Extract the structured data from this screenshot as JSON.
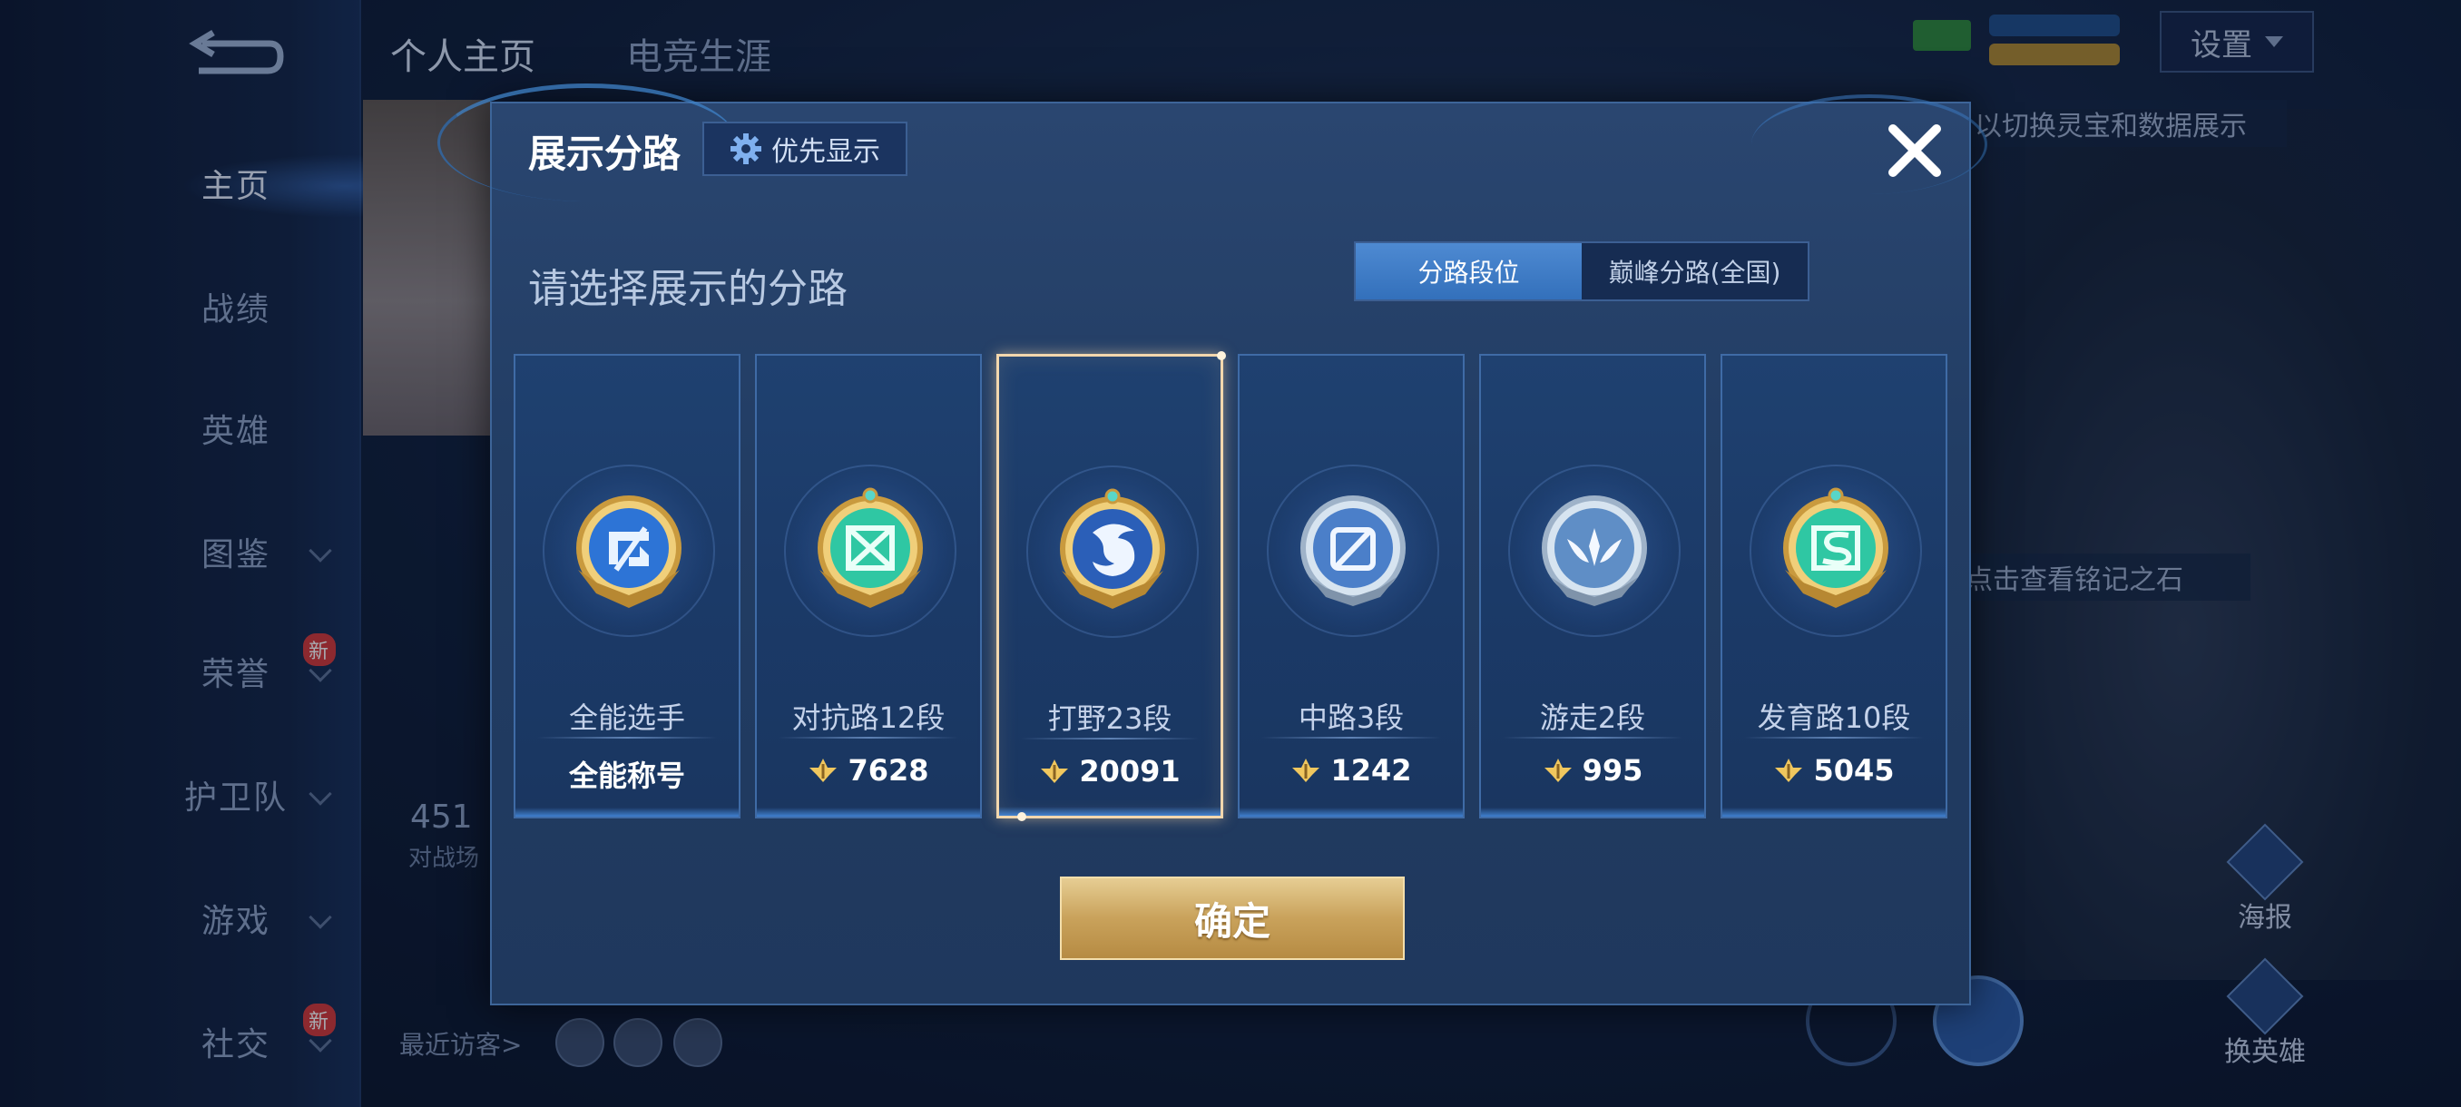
{
  "background": {
    "nav": [
      {
        "label": "主页",
        "active": true,
        "chevron": false,
        "badge": ""
      },
      {
        "label": "战绩",
        "active": false,
        "chevron": false,
        "badge": ""
      },
      {
        "label": "英雄",
        "active": false,
        "chevron": false,
        "badge": ""
      },
      {
        "label": "图鉴",
        "active": false,
        "chevron": true,
        "badge": ""
      },
      {
        "label": "荣誉",
        "active": false,
        "chevron": true,
        "badge": "新"
      },
      {
        "label": "护卫队",
        "active": false,
        "chevron": true,
        "badge": ""
      },
      {
        "label": "游戏",
        "active": false,
        "chevron": true,
        "badge": ""
      },
      {
        "label": "社交",
        "active": false,
        "chevron": true,
        "badge": "新"
      }
    ],
    "top_tabs": [
      "个人主页",
      "电竞生涯"
    ],
    "settings_label": "设置",
    "hint_text": "以切换灵宝和数据展示",
    "hint_text2": "点击查看铭记之石",
    "stat_value": "451",
    "stat_label": "对战场",
    "recent_visitors_label": "最近访客>",
    "side_buttons": [
      "海报",
      "换英雄"
    ]
  },
  "modal": {
    "title": "展示分路",
    "priority_button": "优先显示",
    "section_label": "请选择展示的分路",
    "toggle": {
      "options": [
        "分路段位",
        "巅峰分路(全国)"
      ],
      "selected_index": 0
    },
    "lanes": [
      {
        "name": "全能选手",
        "score": "全能称号",
        "has_score_icon": false,
        "selected": false,
        "emblem": "all-round-emblem-icon"
      },
      {
        "name": "对抗路12段",
        "score": "7628",
        "has_score_icon": true,
        "selected": false,
        "emblem": "clash-lane-emblem-icon"
      },
      {
        "name": "打野23段",
        "score": "20091",
        "has_score_icon": true,
        "selected": true,
        "emblem": "jungle-dragon-emblem-icon"
      },
      {
        "name": "中路3段",
        "score": "1242",
        "has_score_icon": true,
        "selected": false,
        "emblem": "mid-lane-emblem-icon"
      },
      {
        "name": "游走2段",
        "score": "995",
        "has_score_icon": true,
        "selected": false,
        "emblem": "roam-wing-emblem-icon"
      },
      {
        "name": "发育路10段",
        "score": "5045",
        "has_score_icon": true,
        "selected": false,
        "emblem": "farm-lane-emblem-icon"
      }
    ],
    "confirm_label": "确定"
  },
  "colors": {
    "accent_blue": "#3370bb",
    "gold": "#c9a25b",
    "selected_border": "#f3d7ad"
  }
}
